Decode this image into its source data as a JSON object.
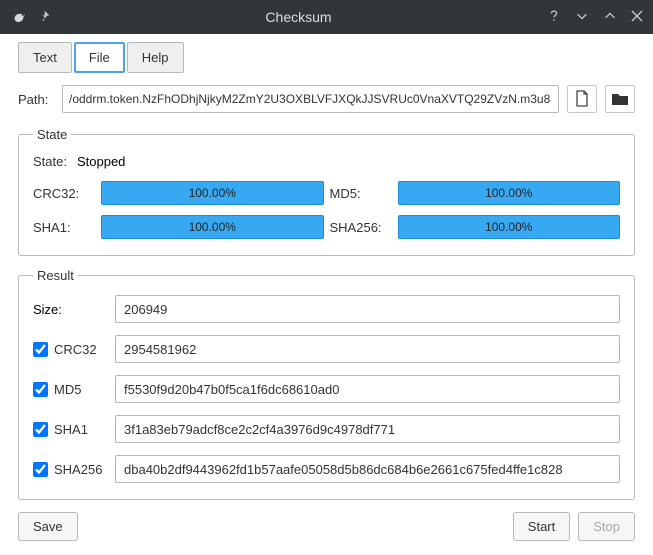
{
  "window": {
    "title": "Checksum"
  },
  "tabs": {
    "text": "Text",
    "file": "File",
    "help": "Help",
    "active": "file"
  },
  "path": {
    "label": "Path:",
    "value": "/oddrm.token.NzFhODhjNjkyM2ZmY2U3OXBLVFJXQkJJSVRUc0VnaXVTQ29ZVzN.m3u8"
  },
  "state": {
    "legend": "State",
    "state_label": "State:",
    "state_value": "Stopped",
    "rows": [
      {
        "name": "CRC32:",
        "pct": "100.00%",
        "name2": "MD5:",
        "pct2": "100.00%"
      },
      {
        "name": "SHA1:",
        "pct": "100.00%",
        "name2": "SHA256:",
        "pct2": "100.00%"
      }
    ]
  },
  "result": {
    "legend": "Result",
    "size_label": "Size:",
    "size": "206949",
    "items": [
      {
        "name": "CRC32",
        "checked": true,
        "value": "2954581962"
      },
      {
        "name": "MD5",
        "checked": true,
        "value": "f5530f9d20b47b0f5ca1f6dc68610ad0"
      },
      {
        "name": "SHA1",
        "checked": true,
        "value": "3f1a83eb79adcf8ce2c2cf4a3976d9c4978df771"
      },
      {
        "name": "SHA256",
        "checked": true,
        "value": "dba40b2df9443962fd1b57aafe05058d5b86dc684b6e2661c675fed4ffe1c828"
      }
    ]
  },
  "buttons": {
    "save": "Save",
    "start": "Start",
    "stop": "Stop"
  }
}
